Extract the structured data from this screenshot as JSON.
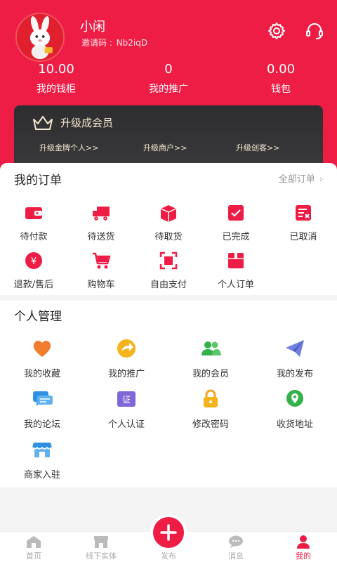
{
  "profile": {
    "name": "小闲",
    "invite_label": "邀请码 :",
    "invite_code": "Nb2iqD"
  },
  "header_icons": [
    "gear-icon",
    "headset-icon"
  ],
  "stats": [
    {
      "value": "10.00",
      "label": "我的钱柜"
    },
    {
      "value": "0",
      "label": "我的推广"
    },
    {
      "value": "0.00",
      "label": "钱包"
    }
  ],
  "vip": {
    "title": "升级成会员",
    "links": [
      "升级金牌个人>>",
      "升级商户>>",
      "升级创客>>"
    ]
  },
  "orders": {
    "title": "我的订单",
    "all_label": "全部订单",
    "items": [
      {
        "label": "待付款",
        "icon": "wallet-icon"
      },
      {
        "label": "待送货",
        "icon": "truck-icon"
      },
      {
        "label": "待取货",
        "icon": "package-icon"
      },
      {
        "label": "已完成",
        "icon": "check-box-icon"
      },
      {
        "label": "已取消",
        "icon": "cancel-list-icon"
      },
      {
        "label": "退款/售后",
        "icon": "refund-icon"
      },
      {
        "label": "购物车",
        "icon": "cart-icon"
      },
      {
        "label": "自由支付",
        "icon": "scan-icon"
      },
      {
        "label": "个人订单",
        "icon": "order-box-icon"
      }
    ]
  },
  "management": {
    "title": "个人管理",
    "items": [
      {
        "label": "我的收藏",
        "icon": "heart-icon"
      },
      {
        "label": "我的推广",
        "icon": "share-arrow-icon"
      },
      {
        "label": "我的会员",
        "icon": "members-icon"
      },
      {
        "label": "我的发布",
        "icon": "paper-plane-icon"
      },
      {
        "label": "我的论坛",
        "icon": "chat-icon"
      },
      {
        "label": "个人认证",
        "icon": "certificate-icon"
      },
      {
        "label": "修改密码",
        "icon": "lock-icon"
      },
      {
        "label": "收货地址",
        "icon": "location-icon"
      },
      {
        "label": "商家入驻",
        "icon": "store-icon"
      }
    ]
  },
  "tabbar": [
    {
      "label": "首页",
      "icon": "home-icon"
    },
    {
      "label": "线下实体",
      "icon": "shop-icon"
    },
    {
      "label": "发布",
      "icon": "plus-icon"
    },
    {
      "label": "消息",
      "icon": "message-icon"
    },
    {
      "label": "我的",
      "icon": "user-icon",
      "active": true
    }
  ],
  "colors": {
    "brand": "#ee1d45",
    "vip_text": "#f2e7cf",
    "card_dark": "#333335"
  }
}
